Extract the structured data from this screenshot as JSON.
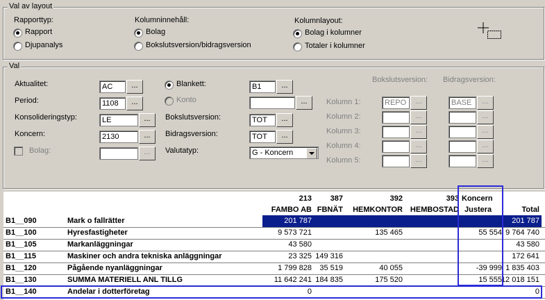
{
  "layout_group": {
    "title": "Val av layout",
    "report_type": {
      "label": "Rapporttyp:",
      "options": [
        "Rapport",
        "Djupanalys"
      ],
      "selected": "Rapport"
    },
    "column_content": {
      "label": "Kolumninnehåll:",
      "options": [
        "Bolag",
        "Bokslutsversion/bidragsversion"
      ],
      "selected": "Bolag"
    },
    "column_layout": {
      "label": "Kolumnlayout:",
      "options": [
        "Bolag i kolumner",
        "Totaler i kolumner"
      ],
      "selected": "Bolag i kolumner"
    }
  },
  "val_group": {
    "title": "Val",
    "aktualitet": {
      "label": "Aktualitet:",
      "value": "AC"
    },
    "period": {
      "label": "Period:",
      "value": "1108"
    },
    "konsolideringstyp": {
      "label": "Konsolideringstyp:",
      "value": "LE"
    },
    "koncern": {
      "label": "Koncern:",
      "value": "2130"
    },
    "bolag": {
      "label": "Bolag:",
      "value": ""
    },
    "blankett": {
      "label": "Blankett:",
      "value": "B1"
    },
    "konto": {
      "label": "Konto",
      "value": ""
    },
    "bokslutsversion": {
      "label": "Bokslutsversion:",
      "value": "TOT"
    },
    "bidragsversion": {
      "label": "Bidragsversion:",
      "value": "TOT"
    },
    "valutatyp": {
      "label": "Valutatyp:",
      "value": "G - Koncern"
    },
    "browse_label": "...",
    "versions": {
      "bokslut_header": "Bokslutsversion:",
      "bidrag_header": "Bidragsversion:",
      "columns": [
        {
          "label": "Kolumn 1:",
          "bokslut": "REPO",
          "bidrag": "BASE"
        },
        {
          "label": "Kolumn 2:",
          "bokslut": "",
          "bidrag": ""
        },
        {
          "label": "Kolumn 3:",
          "bokslut": "",
          "bidrag": ""
        },
        {
          "label": "Kolumn 4:",
          "bokslut": "",
          "bidrag": ""
        },
        {
          "label": "Kolumn 5:",
          "bokslut": "",
          "bidrag": ""
        }
      ]
    }
  },
  "grid": {
    "columns": [
      {
        "num": "213",
        "name": "FAMBO AB"
      },
      {
        "num": "387",
        "name": "FBNÄT"
      },
      {
        "num": "392",
        "name": "HEMKONTOR"
      },
      {
        "num": "393",
        "name": "HEMBOSTAD"
      },
      {
        "num": "Koncern",
        "name": "Justera"
      },
      {
        "num": "",
        "name": "Total"
      }
    ],
    "rows": [
      {
        "code": "B1__090",
        "name": "Mark o fallrätter",
        "values": [
          "201 787",
          "",
          "",
          "",
          "",
          "201 787"
        ]
      },
      {
        "code": "B1__100",
        "name": "Hyresfastigheter",
        "values": [
          "9 573 721",
          "",
          "135 465",
          "",
          "55 554",
          "9 764 740"
        ]
      },
      {
        "code": "B1__105",
        "name": "Markanläggningar",
        "values": [
          "43 580",
          "",
          "",
          "",
          "",
          "43 580"
        ]
      },
      {
        "code": "B1__115",
        "name": "Maskiner och andra tekniska anläggningar",
        "values": [
          "23 325",
          "149 316",
          "",
          "",
          "",
          "172 641"
        ]
      },
      {
        "code": "B1__120",
        "name": "Pågående nyanläggningar",
        "values": [
          "1 799 828",
          "35 519",
          "40 055",
          "",
          "-39 999",
          "1 835 403"
        ]
      },
      {
        "code": "B1__130",
        "name": "SUMMA MATERIELL ANL TILLG",
        "values": [
          "11 642 241",
          "184 835",
          "175 520",
          "",
          "15 555",
          "12 018 151"
        ]
      },
      {
        "code": "B1__140",
        "name": "Andelar i dotterföretag",
        "values": [
          "0",
          "",
          "",
          "",
          "",
          "0"
        ]
      }
    ]
  },
  "colors": {
    "highlight": "#0a1e8c",
    "annotation": "#2b2bd6"
  }
}
